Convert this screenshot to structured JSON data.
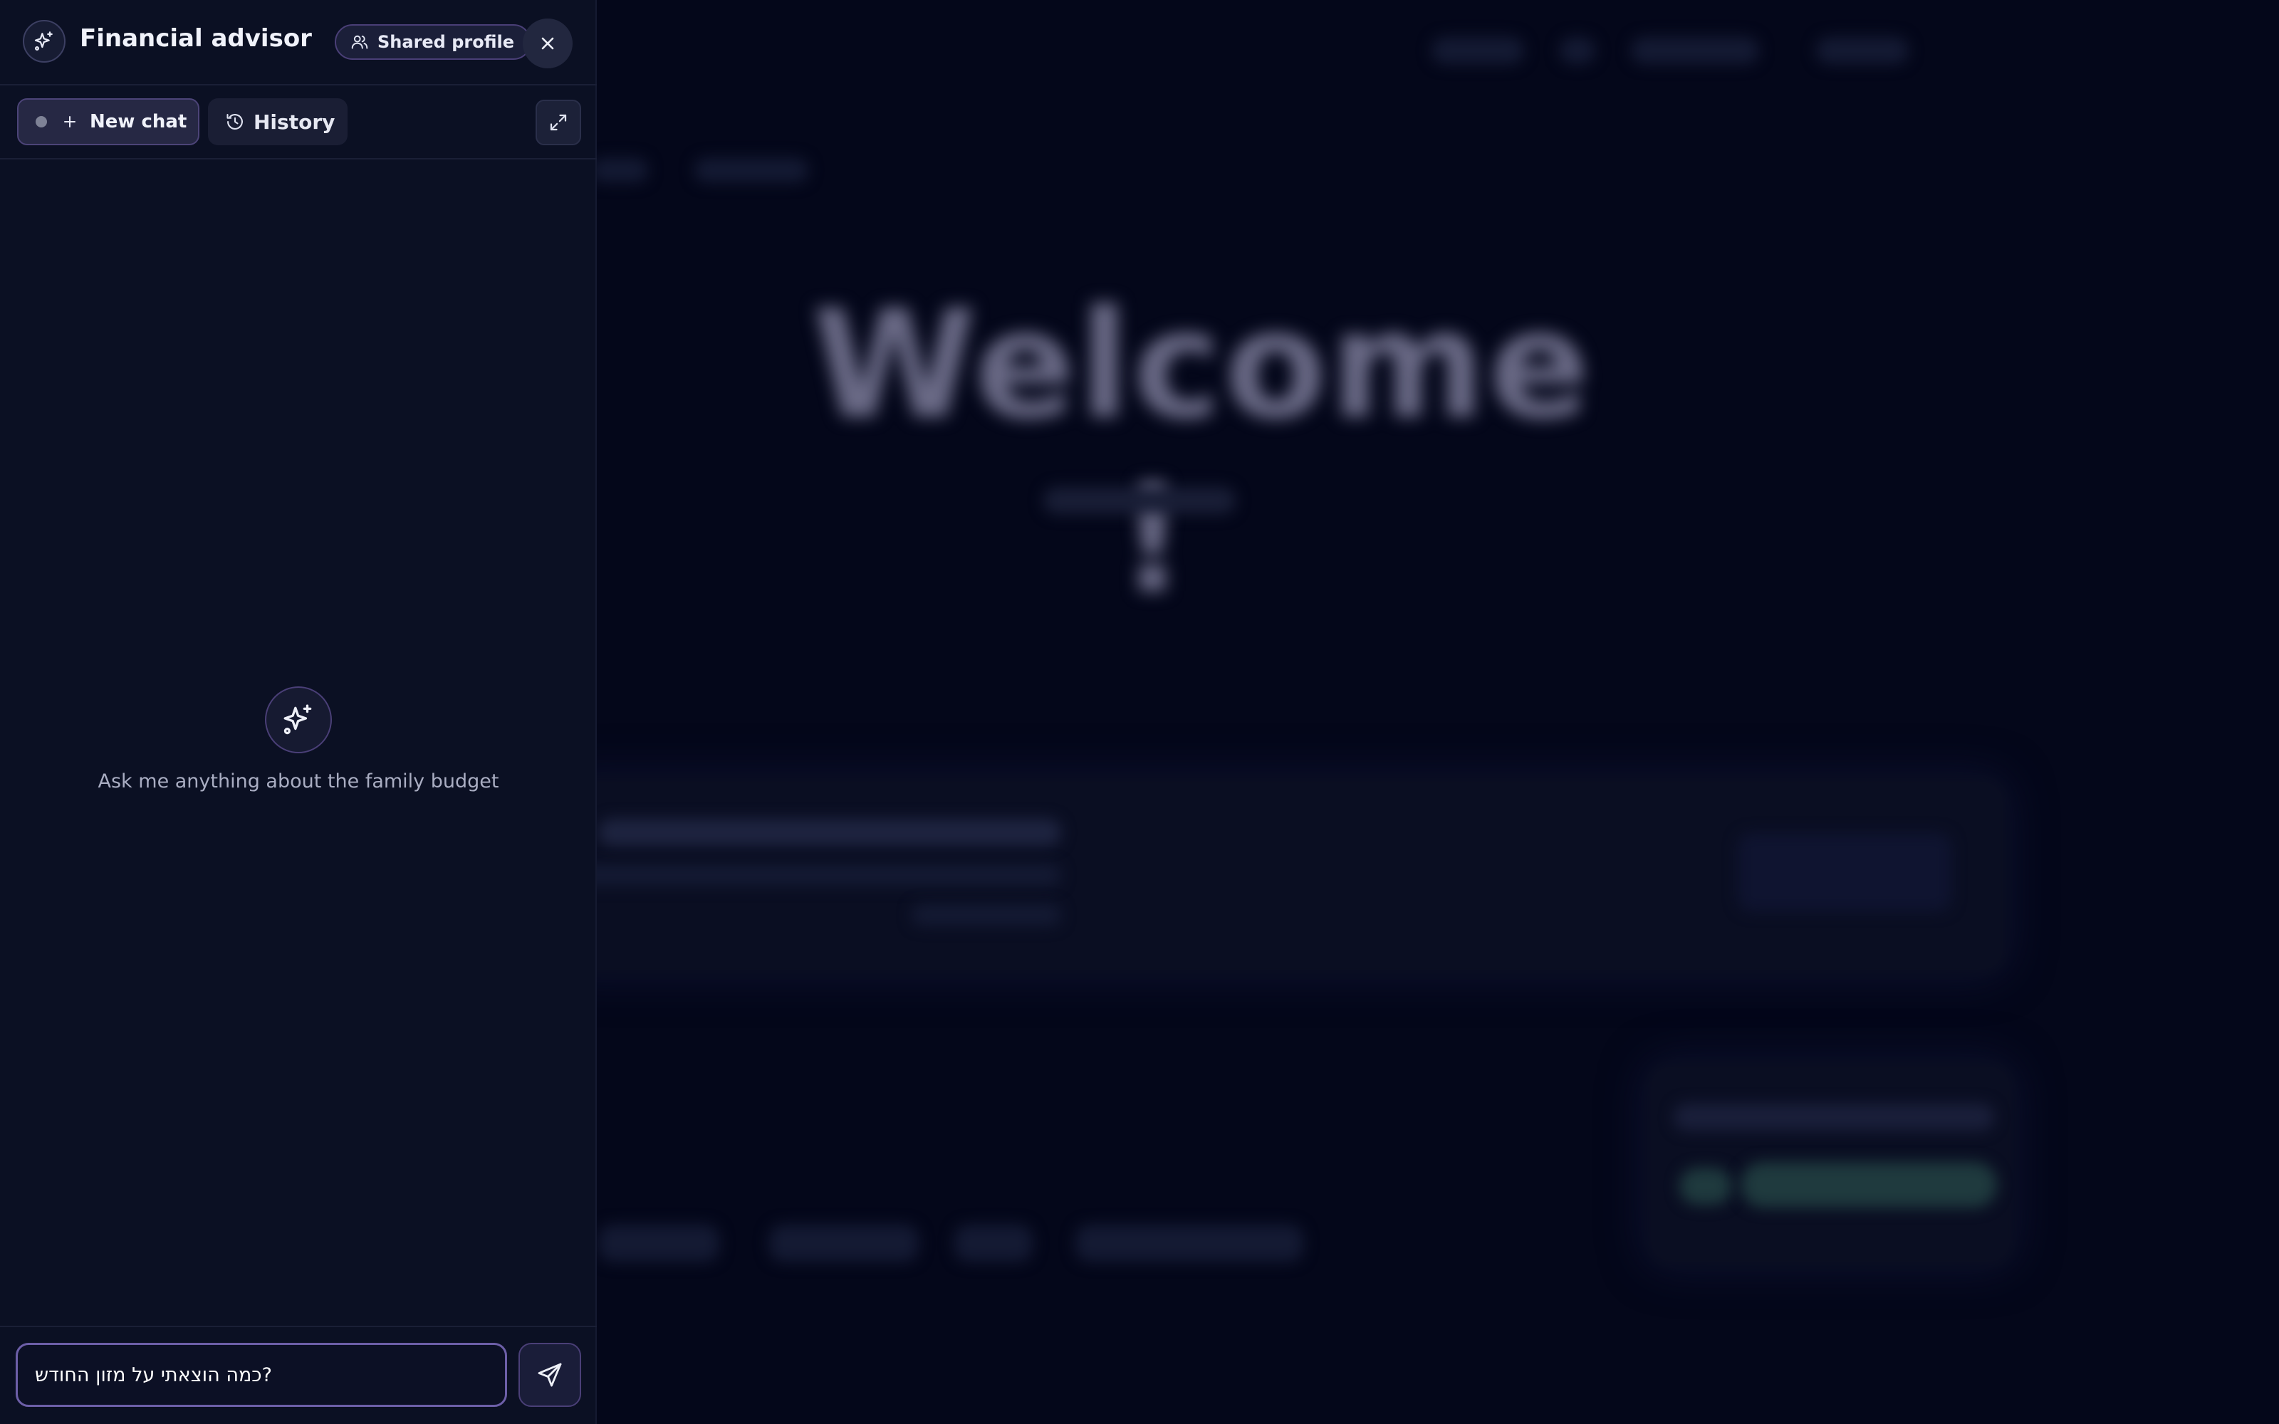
{
  "panel": {
    "title": "Financial advisor",
    "shared_profile_label": "Shared profile",
    "toolbar": {
      "new_chat_label": "New chat",
      "history_label": "History"
    },
    "empty_state": {
      "message": "Ask me anything about the family budget"
    },
    "composer": {
      "value": "כמה הוצאתי על מזון החודש?"
    }
  },
  "background": {
    "heading": "Welcome !"
  },
  "colors": {
    "panel_bg": "#0b1023",
    "page_bg": "#04071a",
    "accent_border": "#6d5fa8"
  }
}
